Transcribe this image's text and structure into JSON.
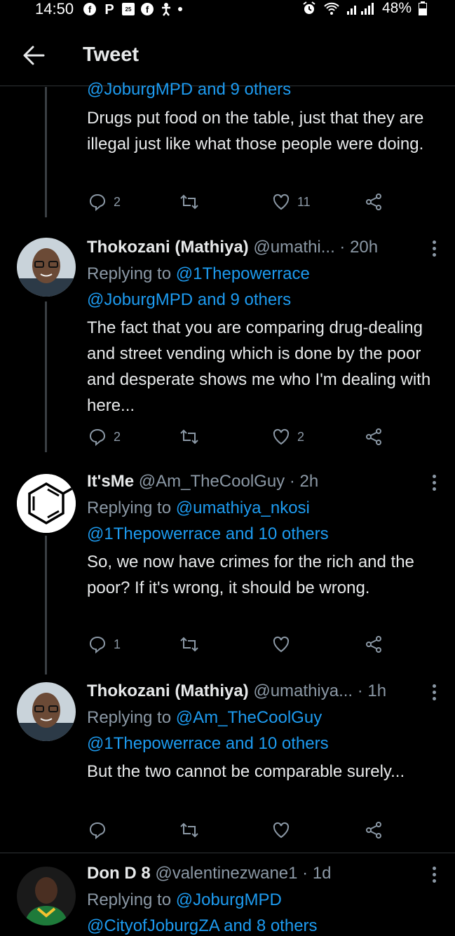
{
  "status_bar": {
    "time": "14:50",
    "calendar_day": "25",
    "battery": "48%",
    "icons": [
      "facebook-icon",
      "pinterest-icon",
      "calendar-icon",
      "facebook-icon",
      "accessibility-icon",
      "dot-icon",
      "alarm-icon",
      "wifi-icon",
      "signal-icon",
      "battery-icon"
    ]
  },
  "header": {
    "title": "Tweet",
    "back_icon": "back-arrow-icon"
  },
  "tweets": [
    {
      "reply_line_partial": "@JoburgMPD and 9 others",
      "body": "Drugs put food on the table, just that they are illegal just like what those people were doing.",
      "replies": "2",
      "retweets": "",
      "likes": "11"
    },
    {
      "name": "Thokozani (Mathiya)",
      "handle": "@umathi...",
      "time": "· 20h",
      "replying_prefix": "Replying to",
      "mention1": "@1Thepowerrace",
      "mention2": "@JoburgMPD and 9 others",
      "body": "The fact that you are comparing drug-dealing and street vending which is done by the poor and desperate shows me who I'm dealing with here...",
      "replies": "2",
      "retweets": "",
      "likes": "2"
    },
    {
      "name": "It'sMe",
      "handle": "@Am_TheCoolGuy",
      "time": "· 2h",
      "replying_prefix": "Replying to",
      "mention1": "@umathiya_nkosi",
      "mention2": "@1Thepowerrace and 10 others",
      "body": "So, we now have crimes for the rich and the poor? If it's wrong, it should be wrong.",
      "replies": "1",
      "retweets": "",
      "likes": ""
    },
    {
      "name": "Thokozani (Mathiya)",
      "handle": "@umathiya...",
      "time": "· 1h",
      "replying_prefix": "Replying to",
      "mention1": "@Am_TheCoolGuy",
      "mention2": "@1Thepowerrace and 10 others",
      "body": "But the two cannot be comparable surely...",
      "replies": "",
      "retweets": "",
      "likes": ""
    },
    {
      "name": "Don D 8",
      "handle": "@valentinezwane1",
      "time": "· 1d",
      "replying_prefix": "Replying to",
      "mention1": "@JoburgMPD",
      "mention2": "@CityofJoburgZA and 8 others"
    }
  ],
  "colors": {
    "background": "#000000",
    "text": "#e7e9ea",
    "muted": "#8b98a5",
    "link": "#1d9bf0",
    "divider": "#2f3336"
  }
}
